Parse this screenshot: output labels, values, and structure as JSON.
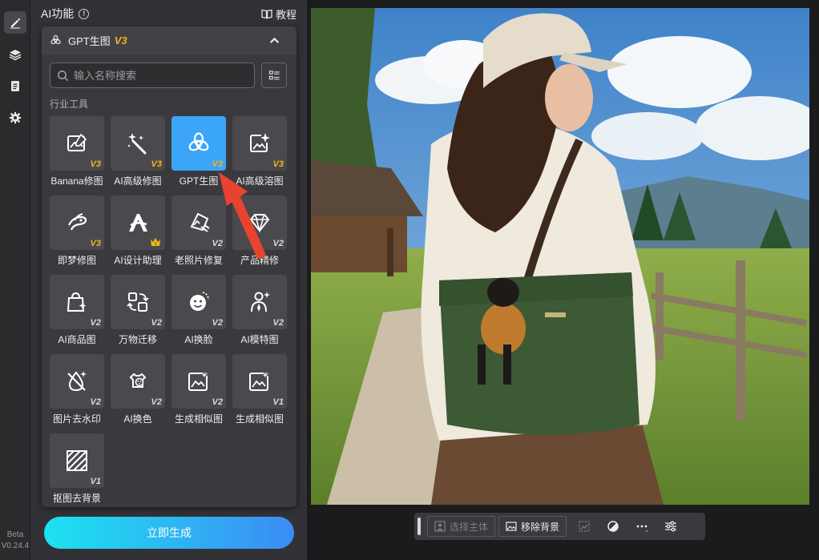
{
  "rail": {
    "items": [
      {
        "icon": "edit-icon",
        "active": true
      },
      {
        "icon": "layers-icon",
        "active": false
      },
      {
        "icon": "clipboard-icon",
        "active": false
      },
      {
        "icon": "gear-icon",
        "active": false
      }
    ],
    "version_line1": "Beta",
    "version_line2": "V0.24.4"
  },
  "panel": {
    "title": "AI功能",
    "info_icon": "!",
    "tutorial_label": "教程"
  },
  "card": {
    "title": "GPT生图",
    "version": "V3",
    "search_placeholder": "输入名称搜索",
    "section_label": "行业工具"
  },
  "tools": [
    {
      "label": "Banana修图",
      "badge": "V3",
      "icon": "image-edit-icon",
      "selected": false
    },
    {
      "label": "AI高级修图",
      "badge": "V3",
      "icon": "magic-wand-icon",
      "selected": false
    },
    {
      "label": "GPT生图",
      "badge": "V3",
      "icon": "openai-icon",
      "selected": true
    },
    {
      "label": "AI高级溶图",
      "badge": "V3",
      "icon": "image-sparkle-icon",
      "selected": false
    },
    {
      "label": "即梦修图",
      "badge": "V3",
      "icon": "dream-icon",
      "selected": false
    },
    {
      "label": "AI设计助理",
      "badge": "",
      "icon": "design-assistant-icon",
      "selected": false
    },
    {
      "label": "老照片修复",
      "badge": "V2",
      "icon": "photo-restore-icon",
      "selected": false
    },
    {
      "label": "产品精修",
      "badge": "V2",
      "icon": "diamond-icon",
      "selected": false
    },
    {
      "label": "AI商品图",
      "badge": "V2",
      "icon": "shopping-bag-icon",
      "selected": false
    },
    {
      "label": "万物迁移",
      "badge": "V2",
      "icon": "transfer-icon",
      "selected": false
    },
    {
      "label": "AI换脸",
      "badge": "V2",
      "icon": "face-swap-icon",
      "selected": false
    },
    {
      "label": "AI模特图",
      "badge": "V2",
      "icon": "model-icon",
      "selected": false
    },
    {
      "label": "图片去水印",
      "badge": "V2",
      "icon": "remove-watermark-icon",
      "selected": false
    },
    {
      "label": "AI换色",
      "badge": "V2",
      "icon": "palette-icon",
      "selected": false
    },
    {
      "label": "生成相似图",
      "badge": "V2",
      "icon": "similar-image-icon",
      "selected": false
    },
    {
      "label": "生成相似图",
      "badge": "V1",
      "icon": "similar-image-icon",
      "selected": false
    },
    {
      "label": "抠图去背景",
      "badge": "V1",
      "icon": "cutout-icon",
      "selected": false
    }
  ],
  "generate_button": "立即生成",
  "bottom_bar": {
    "select_subject": "选择主体",
    "remove_background": "移除背景"
  },
  "colors": {
    "accent_selected": "#3ba6f7",
    "version_badge": "#f5b417",
    "generate_gradient_start": "#1de3f0",
    "generate_gradient_end": "#3b8cf5",
    "arrow": "#e8432e"
  }
}
